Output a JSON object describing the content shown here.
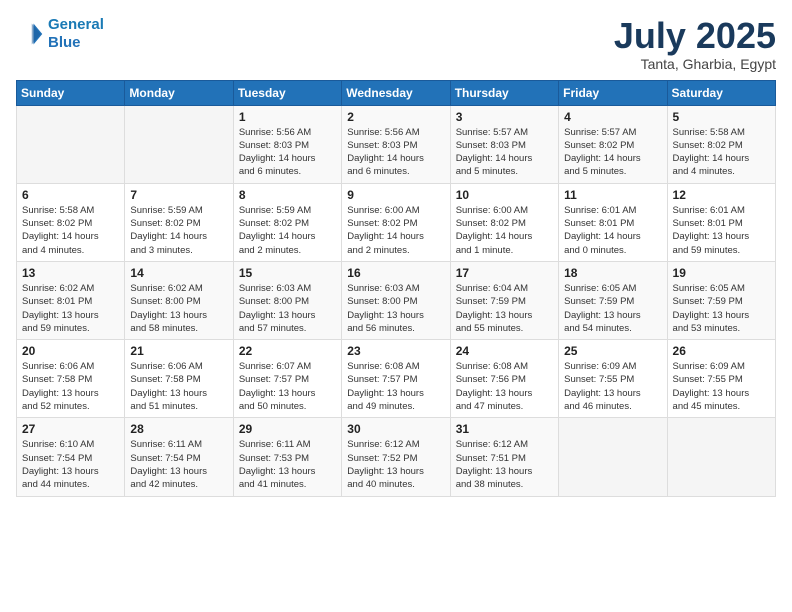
{
  "logo": {
    "line1": "General",
    "line2": "Blue"
  },
  "title": "July 2025",
  "location": "Tanta, Gharbia, Egypt",
  "weekdays": [
    "Sunday",
    "Monday",
    "Tuesday",
    "Wednesday",
    "Thursday",
    "Friday",
    "Saturday"
  ],
  "weeks": [
    [
      {
        "day": "",
        "info": ""
      },
      {
        "day": "",
        "info": ""
      },
      {
        "day": "1",
        "info": "Sunrise: 5:56 AM\nSunset: 8:03 PM\nDaylight: 14 hours\nand 6 minutes."
      },
      {
        "day": "2",
        "info": "Sunrise: 5:56 AM\nSunset: 8:03 PM\nDaylight: 14 hours\nand 6 minutes."
      },
      {
        "day": "3",
        "info": "Sunrise: 5:57 AM\nSunset: 8:03 PM\nDaylight: 14 hours\nand 5 minutes."
      },
      {
        "day": "4",
        "info": "Sunrise: 5:57 AM\nSunset: 8:02 PM\nDaylight: 14 hours\nand 5 minutes."
      },
      {
        "day": "5",
        "info": "Sunrise: 5:58 AM\nSunset: 8:02 PM\nDaylight: 14 hours\nand 4 minutes."
      }
    ],
    [
      {
        "day": "6",
        "info": "Sunrise: 5:58 AM\nSunset: 8:02 PM\nDaylight: 14 hours\nand 4 minutes."
      },
      {
        "day": "7",
        "info": "Sunrise: 5:59 AM\nSunset: 8:02 PM\nDaylight: 14 hours\nand 3 minutes."
      },
      {
        "day": "8",
        "info": "Sunrise: 5:59 AM\nSunset: 8:02 PM\nDaylight: 14 hours\nand 2 minutes."
      },
      {
        "day": "9",
        "info": "Sunrise: 6:00 AM\nSunset: 8:02 PM\nDaylight: 14 hours\nand 2 minutes."
      },
      {
        "day": "10",
        "info": "Sunrise: 6:00 AM\nSunset: 8:02 PM\nDaylight: 14 hours\nand 1 minute."
      },
      {
        "day": "11",
        "info": "Sunrise: 6:01 AM\nSunset: 8:01 PM\nDaylight: 14 hours\nand 0 minutes."
      },
      {
        "day": "12",
        "info": "Sunrise: 6:01 AM\nSunset: 8:01 PM\nDaylight: 13 hours\nand 59 minutes."
      }
    ],
    [
      {
        "day": "13",
        "info": "Sunrise: 6:02 AM\nSunset: 8:01 PM\nDaylight: 13 hours\nand 59 minutes."
      },
      {
        "day": "14",
        "info": "Sunrise: 6:02 AM\nSunset: 8:00 PM\nDaylight: 13 hours\nand 58 minutes."
      },
      {
        "day": "15",
        "info": "Sunrise: 6:03 AM\nSunset: 8:00 PM\nDaylight: 13 hours\nand 57 minutes."
      },
      {
        "day": "16",
        "info": "Sunrise: 6:03 AM\nSunset: 8:00 PM\nDaylight: 13 hours\nand 56 minutes."
      },
      {
        "day": "17",
        "info": "Sunrise: 6:04 AM\nSunset: 7:59 PM\nDaylight: 13 hours\nand 55 minutes."
      },
      {
        "day": "18",
        "info": "Sunrise: 6:05 AM\nSunset: 7:59 PM\nDaylight: 13 hours\nand 54 minutes."
      },
      {
        "day": "19",
        "info": "Sunrise: 6:05 AM\nSunset: 7:59 PM\nDaylight: 13 hours\nand 53 minutes."
      }
    ],
    [
      {
        "day": "20",
        "info": "Sunrise: 6:06 AM\nSunset: 7:58 PM\nDaylight: 13 hours\nand 52 minutes."
      },
      {
        "day": "21",
        "info": "Sunrise: 6:06 AM\nSunset: 7:58 PM\nDaylight: 13 hours\nand 51 minutes."
      },
      {
        "day": "22",
        "info": "Sunrise: 6:07 AM\nSunset: 7:57 PM\nDaylight: 13 hours\nand 50 minutes."
      },
      {
        "day": "23",
        "info": "Sunrise: 6:08 AM\nSunset: 7:57 PM\nDaylight: 13 hours\nand 49 minutes."
      },
      {
        "day": "24",
        "info": "Sunrise: 6:08 AM\nSunset: 7:56 PM\nDaylight: 13 hours\nand 47 minutes."
      },
      {
        "day": "25",
        "info": "Sunrise: 6:09 AM\nSunset: 7:55 PM\nDaylight: 13 hours\nand 46 minutes."
      },
      {
        "day": "26",
        "info": "Sunrise: 6:09 AM\nSunset: 7:55 PM\nDaylight: 13 hours\nand 45 minutes."
      }
    ],
    [
      {
        "day": "27",
        "info": "Sunrise: 6:10 AM\nSunset: 7:54 PM\nDaylight: 13 hours\nand 44 minutes."
      },
      {
        "day": "28",
        "info": "Sunrise: 6:11 AM\nSunset: 7:54 PM\nDaylight: 13 hours\nand 42 minutes."
      },
      {
        "day": "29",
        "info": "Sunrise: 6:11 AM\nSunset: 7:53 PM\nDaylight: 13 hours\nand 41 minutes."
      },
      {
        "day": "30",
        "info": "Sunrise: 6:12 AM\nSunset: 7:52 PM\nDaylight: 13 hours\nand 40 minutes."
      },
      {
        "day": "31",
        "info": "Sunrise: 6:12 AM\nSunset: 7:51 PM\nDaylight: 13 hours\nand 38 minutes."
      },
      {
        "day": "",
        "info": ""
      },
      {
        "day": "",
        "info": ""
      }
    ]
  ]
}
